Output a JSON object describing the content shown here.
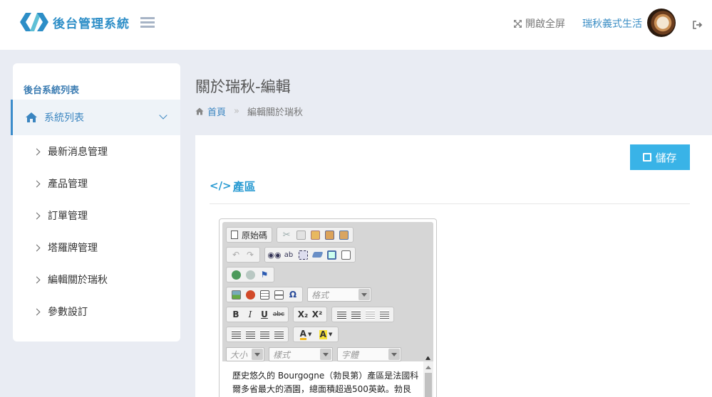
{
  "header": {
    "logo_text": "後台管理系統",
    "fullscreen_label": "開啟全屏",
    "user_name": "瑞秋義式生活",
    "brand_color": "#2d8ec7"
  },
  "sidebar": {
    "title": "後台系統列表",
    "section_label": "系統列表",
    "items": [
      {
        "label": "最新消息管理"
      },
      {
        "label": "產品管理"
      },
      {
        "label": "訂單管理"
      },
      {
        "label": "塔羅牌管理"
      },
      {
        "label": "編輯關於瑞秋"
      },
      {
        "label": "參數設訂"
      }
    ]
  },
  "page": {
    "title": "關於瑞秋-編輯",
    "breadcrumb_home": "首頁",
    "breadcrumb_sep": "»",
    "breadcrumb_current": "編輯關於瑞秋"
  },
  "panel": {
    "save_label": "儲存",
    "section_code": "</>",
    "section_title": "產區",
    "accent_color": "#39b3e7"
  },
  "editor": {
    "source_label": "原始碼",
    "format_combo": "格式",
    "size_combo": "大小",
    "style_combo": "樣式",
    "font_combo": "字體",
    "bold": "B",
    "italic": "I",
    "underline": "U",
    "strike": "abc",
    "subscript": "X₂",
    "superscript": "X²",
    "omega": "Ω",
    "content": "歷史悠久的 Bourgogne（勃艮第）產區是法國科爾多省最大的酒園，總面積超過500英畝。勃艮第以葡萄酒出產世界上最好的酒種之一"
  }
}
